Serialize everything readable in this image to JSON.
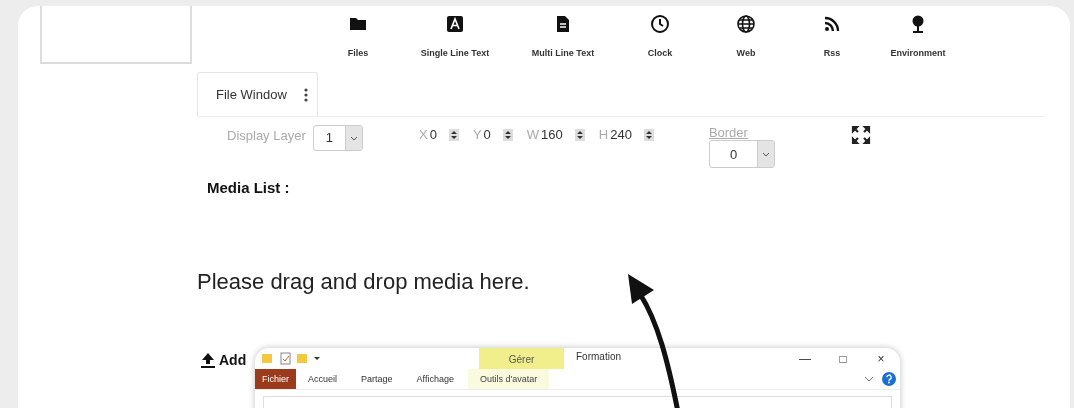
{
  "toolbar": [
    {
      "label": "Files",
      "kind": "folder"
    },
    {
      "label": "Single Line Text",
      "kind": "text"
    },
    {
      "label": "Multi Line Text",
      "kind": "doc"
    },
    {
      "label": "Clock",
      "kind": "clock"
    },
    {
      "label": "Web",
      "kind": "globe"
    },
    {
      "label": "Rss",
      "kind": "rss"
    },
    {
      "label": "Environment",
      "kind": "tree"
    }
  ],
  "tabs": [
    {
      "label": "File Window",
      "selected": true
    }
  ],
  "properties": {
    "display_layer": {
      "label": "Display Layer",
      "value": "1"
    },
    "coords": [
      {
        "label": "X",
        "value": "0"
      },
      {
        "label": "Y",
        "value": "0"
      },
      {
        "label": "W",
        "value": "160"
      },
      {
        "label": "H",
        "value": "240"
      }
    ],
    "border": {
      "label": "Border",
      "value": "0"
    }
  },
  "media_list_label": "Media List :",
  "drop_hint": "Please drag and drop media here.",
  "add_button": "Add",
  "explorer": {
    "context_tab": "Gérer",
    "title": "Formation",
    "window_buttons": [
      "—",
      "□",
      "×"
    ],
    "ribbon_tabs": [
      {
        "label": "Fichier",
        "kind": "file"
      },
      {
        "label": "Accueil",
        "kind": "tab"
      },
      {
        "label": "Partage",
        "kind": "tab"
      },
      {
        "label": "Affichage",
        "kind": "tab"
      },
      {
        "label": "Outils d'avatar",
        "kind": "context"
      }
    ]
  }
}
